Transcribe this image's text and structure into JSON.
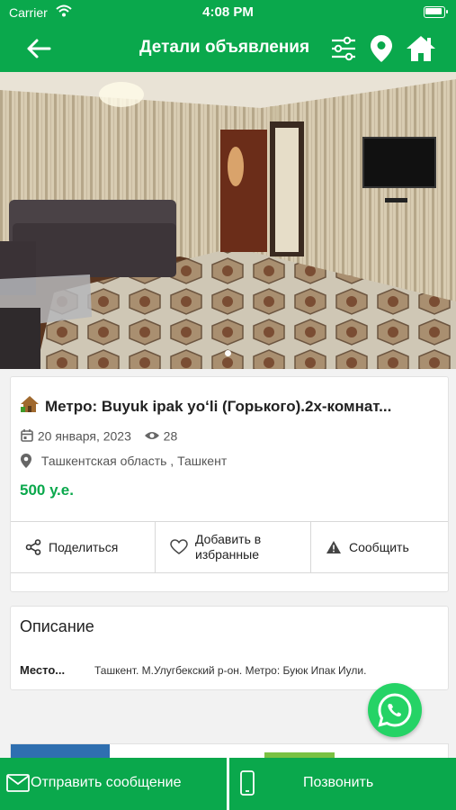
{
  "status_bar": {
    "carrier": "Carrier",
    "time": "4:08 PM"
  },
  "nav": {
    "title": "Детали объявления"
  },
  "listing": {
    "title": "Метро: Buyuk ipak yoʻli (Горького).2х-комнат...",
    "date": "20 января, 2023",
    "views": "28",
    "location": "Ташкентская область , Ташкент",
    "price": "500 у.е."
  },
  "actions": {
    "share": "Поделиться",
    "favorite": "Добавить в избранные",
    "report": "Сообщить"
  },
  "description": {
    "heading": "Описание",
    "rows": [
      {
        "key": "Место...",
        "value": "Ташкент. М.Улугбекский р-он. Метро: Буюк Ипак Иули."
      }
    ]
  },
  "bottom": {
    "send_message": "Отправить сообщение",
    "call": "Позвонить"
  },
  "colors": {
    "brand_green": "#0aa84c",
    "whatsapp_green": "#25d366"
  }
}
